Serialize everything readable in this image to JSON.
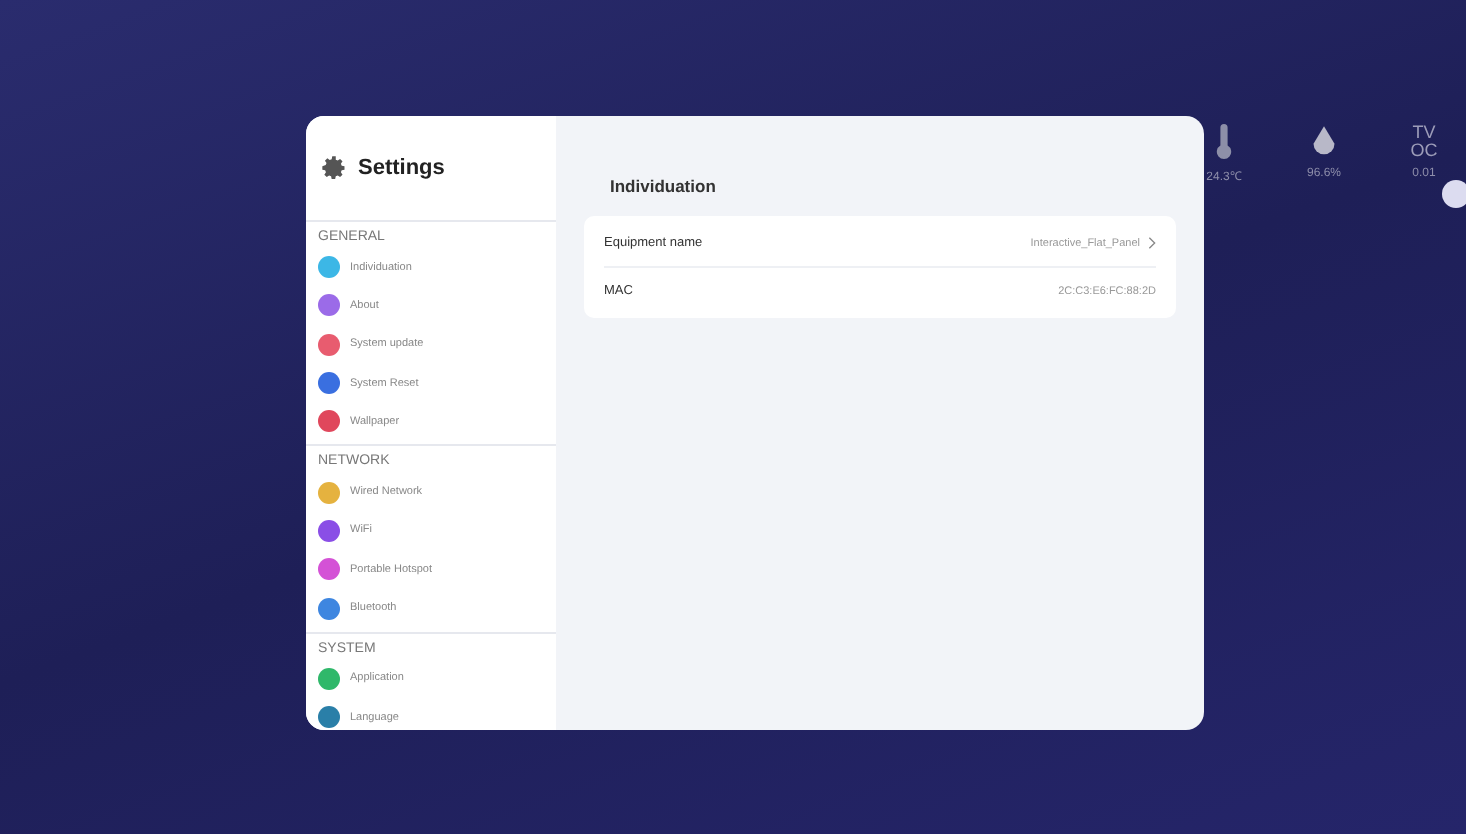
{
  "sensors": [
    {
      "kind": "thermometer",
      "reading": "24.3℃"
    },
    {
      "kind": "drop",
      "reading": "96.6%"
    },
    {
      "kind": "label",
      "label": "TVOC",
      "reading": "0.01"
    }
  ],
  "window": {
    "title": "Settings"
  },
  "sidebar": {
    "sections": [
      {
        "title": "GENERAL",
        "items": [
          {
            "label": "Individuation",
            "color": "#3cb7e6"
          },
          {
            "label": "About",
            "color": "#9b6be8"
          },
          {
            "label": "System update",
            "color": "#e85c6f"
          },
          {
            "label": "System Reset",
            "color": "#3a6fe0"
          },
          {
            "label": "Wallpaper",
            "color": "#e0475c"
          }
        ]
      },
      {
        "title": "NETWORK",
        "items": [
          {
            "label": "Wired Network",
            "color": "#e5b23f"
          },
          {
            "label": "WiFi",
            "color": "#8a4ee6"
          },
          {
            "label": "Portable Hotspot",
            "color": "#d452d6"
          },
          {
            "label": "Bluetooth",
            "color": "#3e86e0"
          }
        ]
      },
      {
        "title": "SYSTEM",
        "items": [
          {
            "label": "Application",
            "color": "#2fb86a"
          },
          {
            "label": "Language",
            "color": "#2a7fa8"
          }
        ]
      }
    ]
  },
  "content": {
    "title": "Individuation",
    "rows": [
      {
        "label": "Equipment name",
        "value": "Interactive_Flat_Panel",
        "chevron": true
      },
      {
        "label": "MAC",
        "value": "2C:C3:E6:FC:88:2D",
        "chevron": false
      }
    ]
  }
}
